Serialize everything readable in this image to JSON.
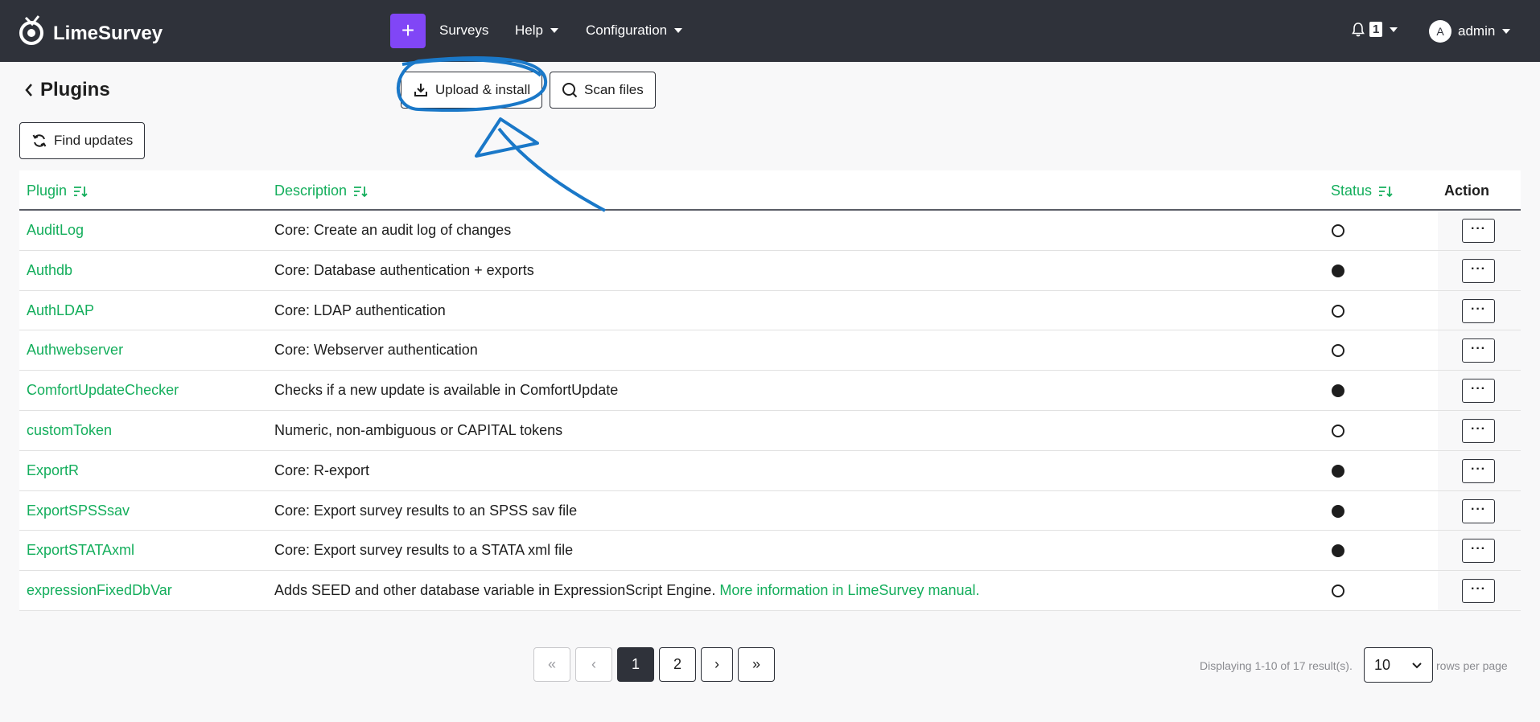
{
  "navbar": {
    "brand": "LimeSurvey",
    "plus_label": "+",
    "menu": [
      {
        "label": "Surveys"
      },
      {
        "label": "Help"
      },
      {
        "label": "Configuration"
      }
    ],
    "notification_count": "1",
    "user_initial": "A",
    "user_name": "admin"
  },
  "page": {
    "title": "Plugins",
    "upload_label": "Upload & install",
    "scan_label": "Scan files",
    "find_updates_label": "Find updates"
  },
  "table": {
    "headers": {
      "plugin": "Plugin",
      "description": "Description",
      "status": "Status",
      "action": "Action"
    },
    "action_label": "···",
    "rows": [
      {
        "name": "AuditLog",
        "description": "Core: Create an audit log of changes",
        "active": false
      },
      {
        "name": "Authdb",
        "description": "Core: Database authentication + exports",
        "active": true
      },
      {
        "name": "AuthLDAP",
        "description": "Core: LDAP authentication",
        "active": false
      },
      {
        "name": "Authwebserver",
        "description": "Core: Webserver authentication",
        "active": false
      },
      {
        "name": "ComfortUpdateChecker",
        "description": "Checks if a new update is available in ComfortUpdate",
        "active": true
      },
      {
        "name": "customToken",
        "description": "Numeric, non-ambiguous or CAPITAL tokens",
        "active": false
      },
      {
        "name": "ExportR",
        "description": "Core: R-export",
        "active": true
      },
      {
        "name": "ExportSPSSsav",
        "description": "Core: Export survey results to an SPSS sav file",
        "active": true
      },
      {
        "name": "ExportSTATAxml",
        "description": "Core: Export survey results to a STATA xml file",
        "active": true
      },
      {
        "name": "expressionFixedDbVar",
        "description": "Adds SEED and other database variable in ExpressionScript Engine.",
        "link": "More information in LimeSurvey manual.",
        "active": false
      }
    ]
  },
  "pagination": {
    "first": "«",
    "prev": "‹",
    "pages": [
      "1",
      "2"
    ],
    "current": "1",
    "next": "›",
    "last": "»",
    "summary": "Displaying 1-10 of 17 result(s).",
    "per_page": "10",
    "per_page_label": "rows per page"
  },
  "colors": {
    "navbar": "#2f323a",
    "accent_purple": "#8146f6",
    "link_green": "#14ae5c",
    "annotation_blue": "#1a78c8"
  }
}
